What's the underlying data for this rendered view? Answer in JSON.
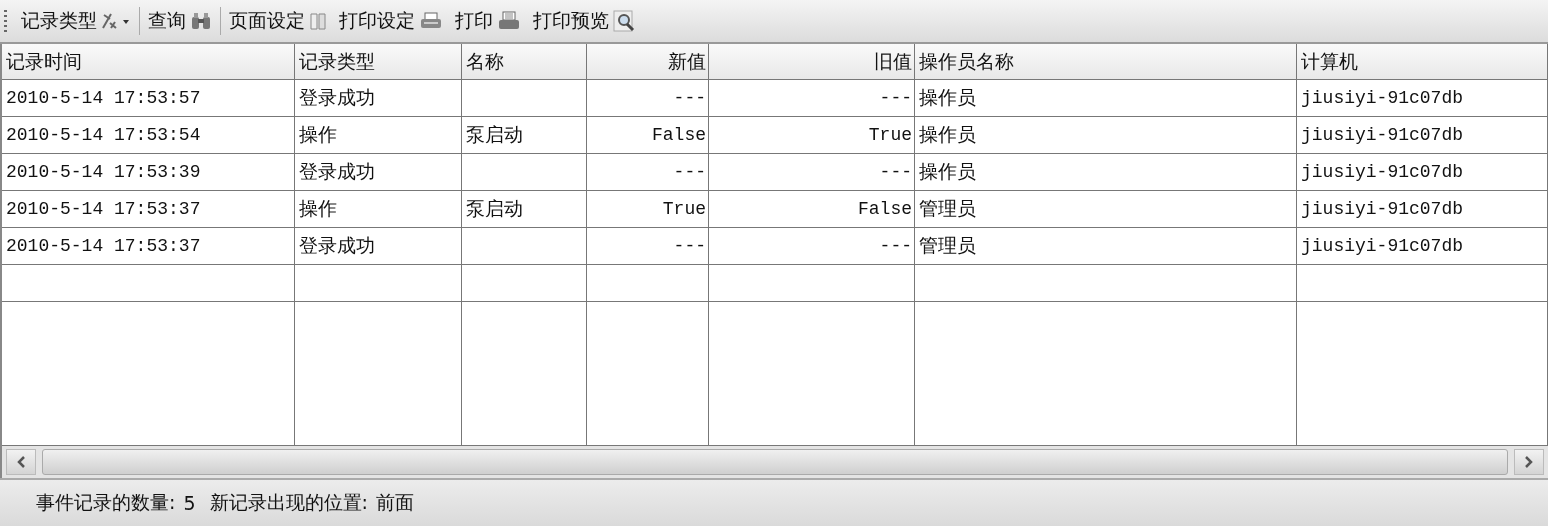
{
  "toolbar": [
    {
      "label": "记录类型",
      "kind": "filter-dropdown",
      "separator_after": true
    },
    {
      "label": "查询",
      "kind": "binoculars",
      "separator_after": true
    },
    {
      "label": "页面设定",
      "kind": "page",
      "separator_after": false
    },
    {
      "label": "打印设定",
      "kind": "printer",
      "separator_after": false
    },
    {
      "label": "打印",
      "kind": "printer-paper",
      "separator_after": false
    },
    {
      "label": "打印预览",
      "kind": "magnifier",
      "separator_after": false
    }
  ],
  "table": {
    "columns": [
      "记录时间",
      "记录类型",
      "名称",
      "新值",
      "旧值",
      "操作员名称",
      "计算机"
    ],
    "rows": [
      [
        "2010-5-14 17:53:57",
        "登录成功",
        "",
        "---",
        "---",
        "操作员",
        "jiusiyi-91c07db"
      ],
      [
        "2010-5-14 17:53:54",
        "操作",
        "泵启动",
        "False",
        "True",
        "操作员",
        "jiusiyi-91c07db"
      ],
      [
        "2010-5-14 17:53:39",
        "登录成功",
        "",
        "---",
        "---",
        "操作员",
        "jiusiyi-91c07db"
      ],
      [
        "2010-5-14 17:53:37",
        "操作",
        "泵启动",
        "True",
        "False",
        "管理员",
        "jiusiyi-91c07db"
      ],
      [
        "2010-5-14 17:53:37",
        "登录成功",
        "",
        "---",
        "---",
        "管理员",
        "jiusiyi-91c07db"
      ]
    ]
  },
  "status_bar": {
    "count_label": "事件记录的数量:",
    "count": "5",
    "position_label": "新记录出现的位置:",
    "position": "前面"
  }
}
